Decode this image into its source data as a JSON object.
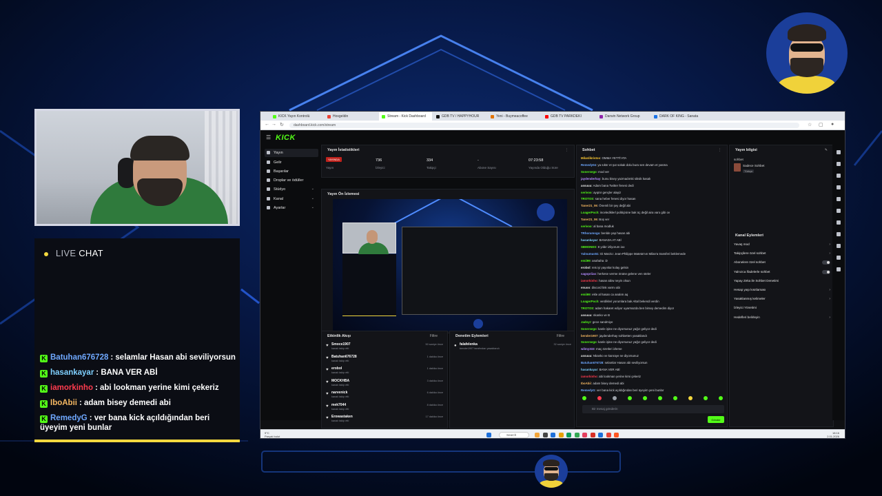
{
  "livechat": {
    "live": "LIVE",
    "chat": "CHAT",
    "messages": [
      {
        "user": "Batuhan676728",
        "text": ": selamlar Hasan abi seviliyorsun",
        "color": "#6fa8ff"
      },
      {
        "user": "hasankayar",
        "text": ": BANA VER ABİ",
        "color": "#7fd0ff"
      },
      {
        "user": "iamorkinho",
        "text": ": abi lookman yerine kimi çekeriz",
        "color": "#ff3b4e"
      },
      {
        "user": "IboAbii",
        "text": ": adam bisey demedi abi",
        "color": "#f5b862"
      },
      {
        "user": "RemedyG",
        "text": ": ver bana kick açıldığından beri üyeyim yeni bunlar",
        "color": "#6fa8ff"
      }
    ]
  },
  "browser": {
    "tabs": [
      {
        "label": "KICK Yayın Kontrolü",
        "fav": "#53fc18"
      },
      {
        "label": "Hosgeldin",
        "fav": "#ea4335"
      },
      {
        "label": "Stream - Kick Dashboard",
        "fav": "#53fc18"
      },
      {
        "label": "GDB TV / HAPPYHOUR",
        "fav": "#111111"
      },
      {
        "label": "Yeni - Buymeacoffee",
        "fav": "#e37400"
      },
      {
        "label": "GDB TV PARKDEKI",
        "fav": "#ff0000"
      },
      {
        "label": "Darwin Network Group",
        "fav": "#8e24aa"
      },
      {
        "label": "DARK OF KING - Sanata",
        "fav": "#1a73e8"
      }
    ],
    "url": "dashboard.kick.com/stream"
  },
  "kick": {
    "logo": "KICK",
    "sidebar": [
      {
        "label": "Yayın",
        "active": true,
        "chev": ""
      },
      {
        "label": "Gelir",
        "active": false,
        "chev": ""
      },
      {
        "label": "Başarılar",
        "active": false,
        "chev": ""
      },
      {
        "label": "Droplar ve ödüller",
        "active": false,
        "chev": ""
      },
      {
        "label": "Stüdyo",
        "active": false,
        "chev": "⌄"
      },
      {
        "label": "Kanal",
        "active": false,
        "chev": "⌄"
      },
      {
        "label": "Ayarlar",
        "active": false,
        "chev": "⌄"
      }
    ],
    "stats": {
      "title": "Yayın İstatistikleri",
      "badge": "YAYINDA",
      "items": [
        {
          "value": "",
          "label": "Yayın"
        },
        {
          "value": "736",
          "label": "İzleyici"
        },
        {
          "value": "334",
          "label": "Takipçi"
        },
        {
          "value": "-",
          "label": "Abone Sayısı"
        },
        {
          "value": "07:23:58",
          "label": "Yayında Olduğu Süre"
        }
      ]
    },
    "preview_title": "Yayın Ön İzlemesi",
    "feed": {
      "title": "Etkinlik Akışı",
      "filter": "Filtre",
      "rows": [
        {
          "name": "Smoce1907",
          "sub": "kanalı takip etti",
          "time": "50 saniye önce"
        },
        {
          "name": "Batuhan676728",
          "sub": "kanalı takip etti",
          "time": "1 dakika önce"
        },
        {
          "name": "erobol",
          "sub": "kanalı takip etti",
          "time": "1 dakika önce"
        },
        {
          "name": "MOCKHBA",
          "sub": "kanalı takip etti",
          "time": "3 dakika önce"
        },
        {
          "name": "narvenick",
          "sub": "kanalı takip etti",
          "time": "6 dakika önce"
        },
        {
          "name": "mek7044",
          "sub": "kanalı takip etti",
          "time": "8 dakika önce"
        },
        {
          "name": "Erowastaken",
          "sub": "kanalı takip etti",
          "time": "17 dakika önce"
        }
      ]
    },
    "mod": {
      "title": "Denetim Eylemleri",
      "filter": "Filtre",
      "name": "falafelenka",
      "sub": "bender1907 tarafından yasaklandı",
      "time": "32 saniye önce"
    },
    "chat": {
      "title": "Sohbet",
      "lines": [
        {
          "u": "Milanlikristos",
          "c": "#ffcc33",
          "t": "OMMA YETTİ'ATA"
        },
        {
          "u": "Remedy04",
          "c": "#6fa8ff",
          "t": "ya sıktır et şut sokak dolu bura sen devam et yasma"
        },
        {
          "u": "Sonersego",
          "c": "#53fc18",
          "t": "mod ver"
        },
        {
          "u": "jaydenderhay",
          "c": "#b58cff",
          "t": "bunu bisey yazmadımki siksik kasalı"
        },
        {
          "u": "assuuu",
          "c": "#e6e6e6",
          "t": "Adam bana Twitter fenesi dedi"
        },
        {
          "u": "serivoo",
          "c": "#53fc18",
          "t": "ayıptır gençler alayiz"
        },
        {
          "u": "TROTOS",
          "c": "#53fc18",
          "t": "sana heber fenesi diyor hasan"
        },
        {
          "u": "Taner21_06",
          "c": "#f5b862",
          "t": "Önemli bir şey değil abi"
        },
        {
          "u": "LoagerPoch",
          "c": "#53fc18",
          "t": "incelediklerl politiçisine bak üç değil aira varo gibi ov"
        },
        {
          "u": "Taner21_06",
          "c": "#f5b862",
          "t": "Boş ver"
        },
        {
          "u": "serivoo",
          "c": "#53fc18",
          "t": "al bana modluk"
        },
        {
          "u": "TRhoramoga",
          "c": "#6fa8ff",
          "t": "benlde yap hasan abi"
        },
        {
          "u": "hasankayar",
          "c": "#7fd0ff",
          "t": "BANADA AT ABİ"
        },
        {
          "u": "SBMONES",
          "c": "#53fc18",
          "t": "8 yıldır izliyorum ioo"
        },
        {
          "u": "Yalnumus51",
          "c": "#6fa8ff",
          "t": "Di Marzio: Jean-Philippe Mateta'nın Milan'a transferi beklemede"
        },
        {
          "u": "emii99",
          "c": "#53fc18",
          "t": "anahaha :D"
        },
        {
          "u": "erobol",
          "c": "#e6e6e6",
          "t": "reis iyi yayınlar kolay gelsin"
        },
        {
          "u": "sagopriias",
          "c": "#b58cff",
          "t": "herkese verme önüne gelene ven steler"
        },
        {
          "u": "iamorkinho",
          "c": "#ff3b4e",
          "t": "hasan abiw neyin olsun"
        },
        {
          "u": "enuoo",
          "c": "#e6e6e6",
          "t": "discord link varmı abi"
        },
        {
          "u": "emii99",
          "c": "#53fc18",
          "t": "ekle al hasan ca analım aq"
        },
        {
          "u": "LoagerPoch",
          "c": "#53fc18",
          "t": "verdikleri yorumlara bak Altal bekendi verdin"
        },
        {
          "u": "TROTOS",
          "c": "#53fc18",
          "t": "adam hakaret ediyor uyarmazda ben birsey demedim diyor"
        },
        {
          "u": "assuuu",
          "c": "#e6e6e6",
          "t": "nkanko ve B"
        },
        {
          "u": "Jadoyr",
          "c": "#53fc18",
          "t": "gece sandmiye"
        },
        {
          "u": "Sonersego",
          "c": "#53fc18",
          "t": "kanle işine ne diyorsunuz yağız geliyor dedi"
        },
        {
          "u": "bender1907",
          "c": "#f5b862",
          "t": "jaydenderhay sohbetten yasaklandı"
        },
        {
          "u": "Sonersego",
          "c": "#53fc18",
          "t": "kanle işine ne diyorsunuz yağız geliyor dedi"
        },
        {
          "u": "wilmy333",
          "c": "#b58cff",
          "t": "maç özetleri izleme"
        },
        {
          "u": "assuuu",
          "c": "#e6e6e6",
          "t": "Nkanko ve kanraye ne diyorsunuz"
        },
        {
          "u": "Batuhan676728",
          "c": "#6fa8ff",
          "t": "selamlar Hasan abi seviliyorsun"
        },
        {
          "u": "hasankayar",
          "c": "#7fd0ff",
          "t": "BANA VER ABİ"
        },
        {
          "u": "iamorkinho",
          "c": "#ff3b4e",
          "t": "abi lookman yerine kimi çekeriz"
        },
        {
          "u": "IboAbii",
          "c": "#f5b862",
          "t": "adam bisey demedi abi"
        },
        {
          "u": "RemedyG",
          "c": "#6fa8ff",
          "t": "ver bana kick açıldığından beri üyeyim yeni bunlar"
        }
      ],
      "input_placeholder": "Bir mesaj gönderin",
      "send": "Gönder"
    },
    "info": {
      "title": "Yayın bilgisi",
      "chat_label": "sohbet",
      "category": "Sadece Sohbet",
      "lang": "Türkçe",
      "actions_title": "Kanal Eylemleri",
      "actions": [
        {
          "label": "Yavaş mod",
          "type": "chev"
        },
        {
          "label": "Takipçilere özel sohbet",
          "type": "chev"
        },
        {
          "label": "Abonelere özel sohbet",
          "type": "toggle"
        },
        {
          "label": "Yalnızca İfadelerle sohbet",
          "type": "toggle"
        },
        {
          "label": "Yapay Zeka ile Sohbet Denetimi",
          "type": "none"
        },
        {
          "label": "Hesap yaşı kısıtlaması",
          "type": "chev"
        },
        {
          "label": "Yasaklanmış kelimeler",
          "type": "chev"
        },
        {
          "label": "İzleyici Yönetimi",
          "type": "none"
        },
        {
          "label": "Hedefleri belirleyin",
          "type": "chev"
        }
      ]
    }
  },
  "taskbar": {
    "weather_temp": "9°C",
    "weather_text": "Parçalı bulut",
    "search": "Search",
    "time": "18:16",
    "date": "2.01.2026"
  }
}
